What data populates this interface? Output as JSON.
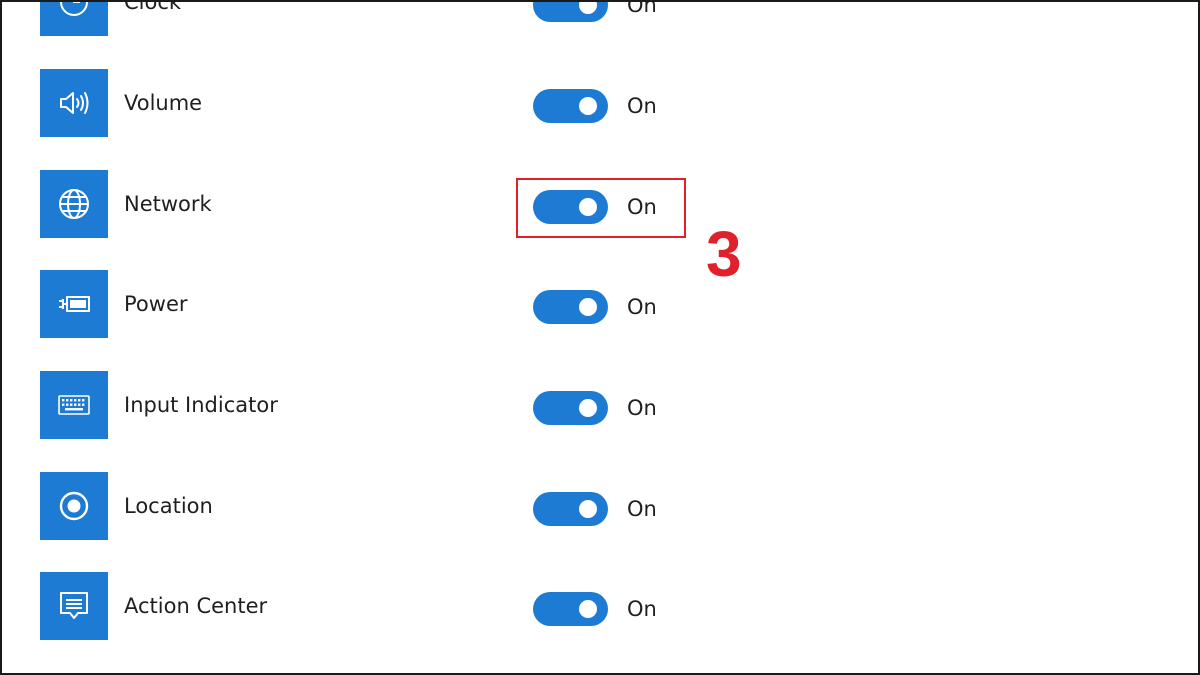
{
  "colors": {
    "accent": "#1e7bd4",
    "annotation": "#e0202a"
  },
  "items": [
    {
      "label": "Clock",
      "icon": "clock-icon",
      "toggle_state": "On",
      "enabled": true
    },
    {
      "label": "Volume",
      "icon": "volume-icon",
      "toggle_state": "On",
      "enabled": true
    },
    {
      "label": "Network",
      "icon": "globe-icon",
      "toggle_state": "On",
      "enabled": true
    },
    {
      "label": "Power",
      "icon": "battery-plug-icon",
      "toggle_state": "On",
      "enabled": true
    },
    {
      "label": "Input Indicator",
      "icon": "keyboard-icon",
      "toggle_state": "On",
      "enabled": true
    },
    {
      "label": "Location",
      "icon": "location-icon",
      "toggle_state": "On",
      "enabled": true
    },
    {
      "label": "Action Center",
      "icon": "action-center-icon",
      "toggle_state": "On",
      "enabled": true
    }
  ],
  "annotation": {
    "step_number": "3",
    "highlighted_item": "Network"
  }
}
